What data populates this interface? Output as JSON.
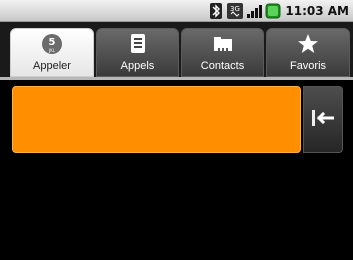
{
  "status_bar": {
    "time": "11:03 AM",
    "icons": [
      "bluetooth-icon",
      "3g-icon",
      "signal-icon",
      "battery-icon"
    ]
  },
  "tabs": [
    {
      "label": "Appeler",
      "icon": "dialpad-icon",
      "badge": "5",
      "badge_sub": "JKL",
      "active": true
    },
    {
      "label": "Appels",
      "icon": "call-log-icon",
      "active": false
    },
    {
      "label": "Contacts",
      "icon": "contacts-icon",
      "active": false
    },
    {
      "label": "Favoris",
      "icon": "star-icon",
      "active": false
    }
  ],
  "dialer": {
    "digits": "",
    "accent_color": "#ff8f00"
  }
}
